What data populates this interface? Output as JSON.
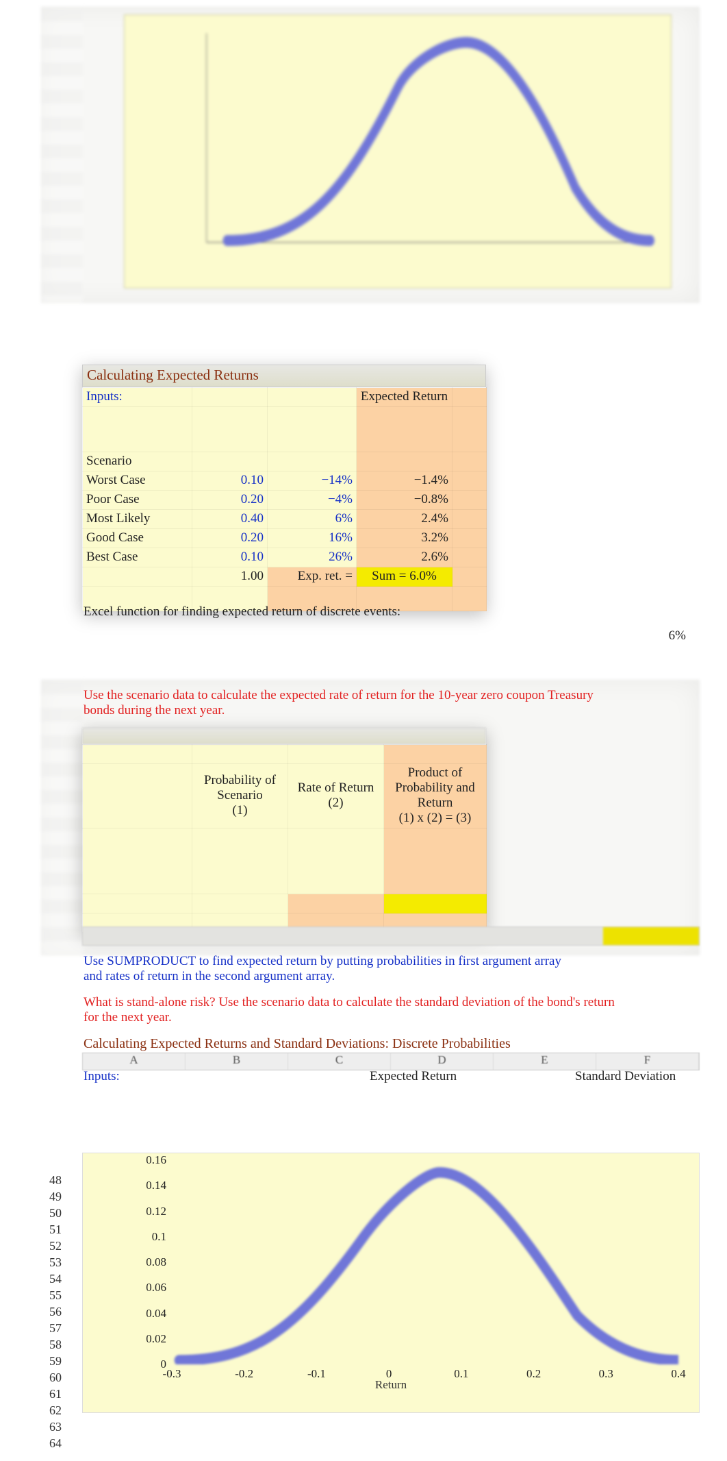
{
  "chart_data": {
    "type": "line",
    "title": "",
    "xlabel": "Return",
    "xlim": [
      -0.3,
      0.4
    ],
    "ylim": [
      0,
      0.16
    ],
    "x_ticks": [
      "-0.3",
      "-0.2",
      "-0.1",
      "0",
      "0.1",
      "0.2",
      "0.3",
      "0.4"
    ],
    "y_ticks": [
      "0",
      "0.02",
      "0.04",
      "0.06",
      "0.08",
      "0.1",
      "0.12",
      "0.14",
      "0.16"
    ],
    "x": [
      -0.3,
      -0.25,
      -0.2,
      -0.15,
      -0.1,
      -0.05,
      0.0,
      0.05,
      0.1,
      0.15,
      0.2,
      0.25,
      0.3,
      0.35,
      0.4
    ],
    "values": [
      0.003,
      0.006,
      0.012,
      0.025,
      0.045,
      0.08,
      0.12,
      0.15,
      0.155,
      0.14,
      0.105,
      0.07,
      0.04,
      0.02,
      0.01
    ]
  },
  "section1": {
    "title": "Calculating Expected Returns",
    "inputs_label": "Inputs:",
    "expret_header": "Expected Return",
    "scenario_header": "Scenario",
    "rows": [
      {
        "name": "Worst Case",
        "prob": "0.10",
        "ret": "−14%",
        "prod": "−1.4%"
      },
      {
        "name": "Poor Case",
        "prob": "0.20",
        "ret": "−4%",
        "prod": "−0.8%"
      },
      {
        "name": "Most Likely",
        "prob": "0.40",
        "ret": "6%",
        "prod": "2.4%"
      },
      {
        "name": "Good Case",
        "prob": "0.20",
        "ret": "16%",
        "prod": "3.2%"
      },
      {
        "name": "Best Case",
        "prob": "0.10",
        "ret": "26%",
        "prod": "2.6%"
      }
    ],
    "sumprob": "1.00",
    "expret_label": "Exp. ret. =",
    "sum_label": "Sum = 6.0%",
    "excel_note": "Excel function for finding expected return of discrete events:",
    "excel_result": "6%"
  },
  "section2": {
    "prompt": " Use the scenario data to calculate the expected rate of return for the 10-year zero coupon Treasury bonds during the next year.",
    "col_prob": "Probability of Scenario",
    "col_prob_sub": "(1)",
    "col_ret": "Rate of Return",
    "col_ret_sub": "(2)",
    "col_prod": "Product of Probability and Return",
    "col_prod_sub": "(1) x (2) = (3)",
    "sumproduct_note": "Use SUMPRODUCT to find expected return by putting probabilities in first argument array and rates of return in the second argument array.",
    "question": "What is stand-alone risk? Use the scenario data to calculate the standard deviation of the bond's return for the next year."
  },
  "section3": {
    "title": "Calculating Expected Returns and Standard Deviations: Discrete Probabilities",
    "inputs_label": "Inputs:",
    "expret_header": "Expected Return",
    "std_header": "Standard Deviation",
    "columns": [
      "A",
      "B",
      "C",
      "D",
      "E",
      "F"
    ],
    "rows_start": 48,
    "rows_end": 64
  }
}
